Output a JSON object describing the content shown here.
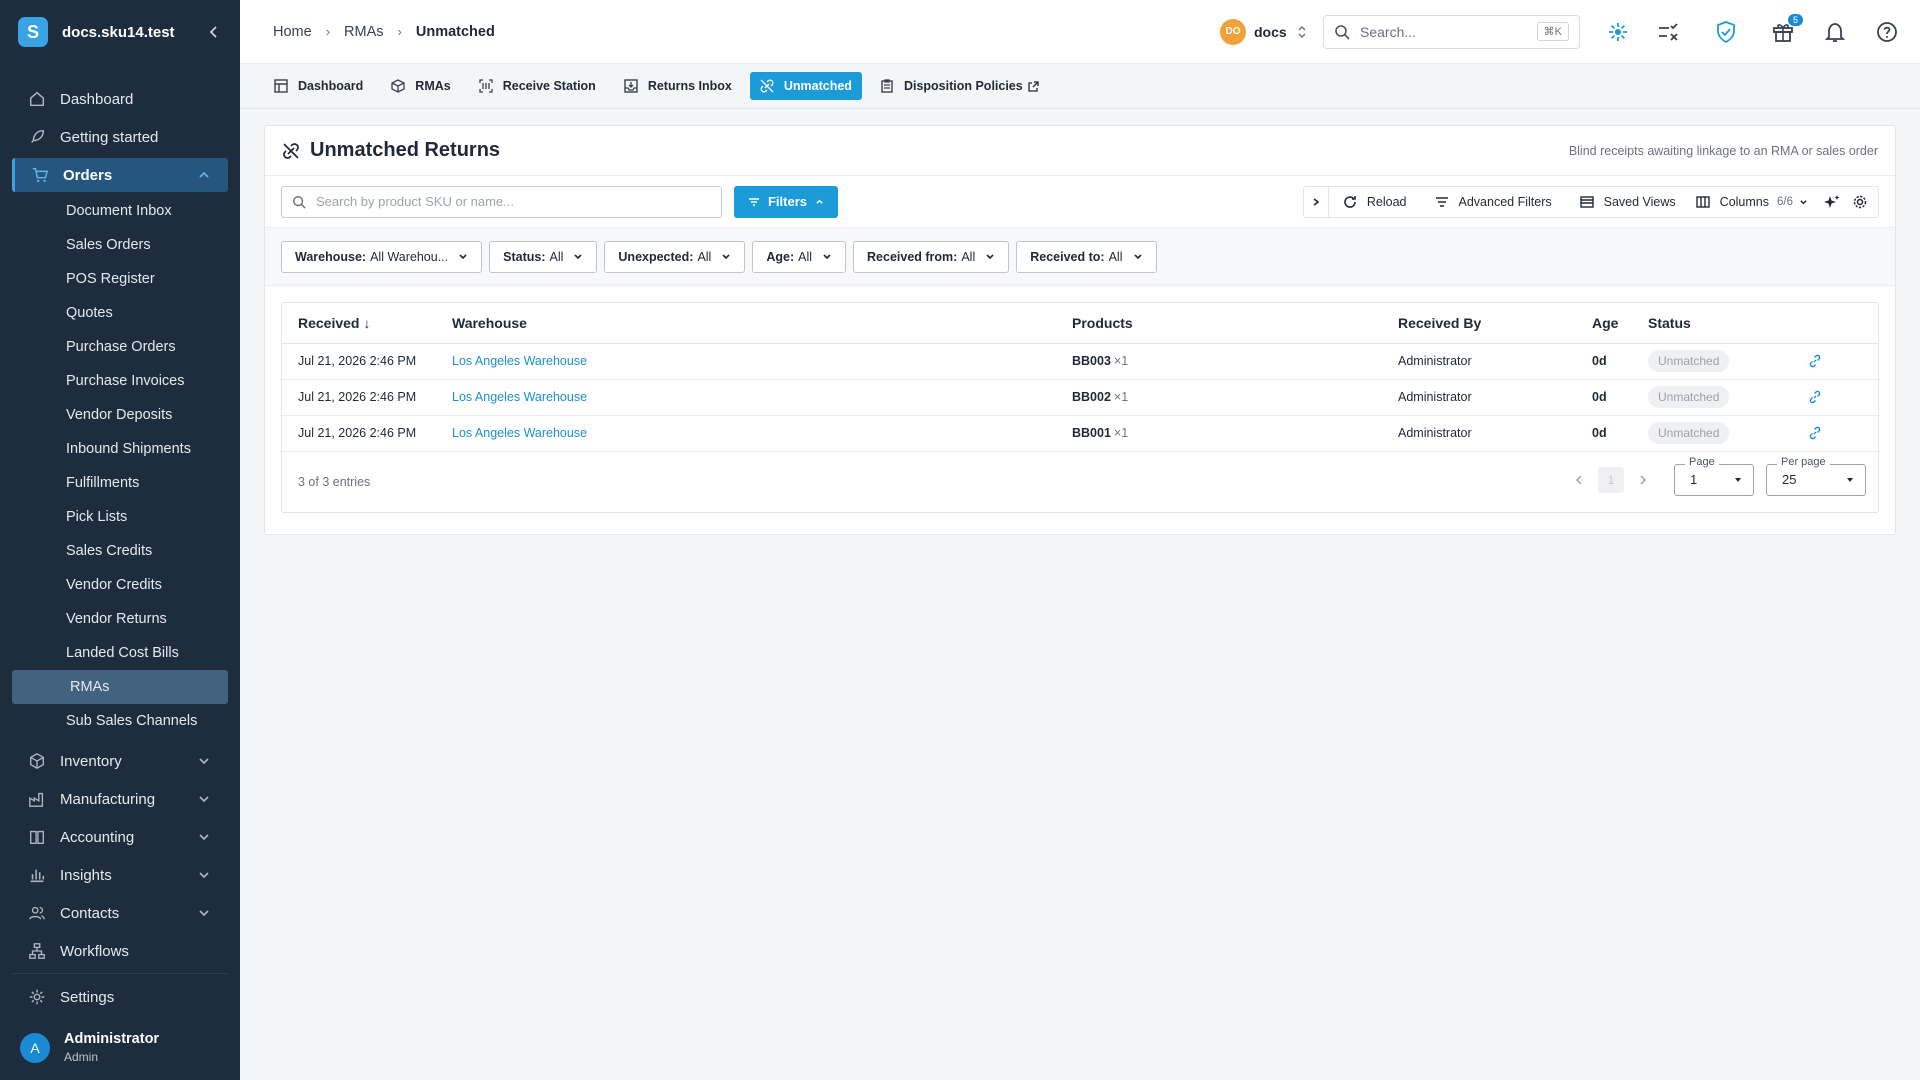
{
  "sidebar": {
    "domain": "docs.sku14.test",
    "top_items": [
      {
        "label": "Dashboard"
      },
      {
        "label": "Getting started"
      },
      {
        "label": "Orders"
      }
    ],
    "orders_sub": [
      "Document Inbox",
      "Sales Orders",
      "POS Register",
      "Quotes",
      "Purchase Orders",
      "Purchase Invoices",
      "Vendor Deposits",
      "Inbound Shipments",
      "Fulfillments",
      "Pick Lists",
      "Sales Credits",
      "Vendor Credits",
      "Vendor Returns",
      "Landed Cost Bills",
      "RMAs",
      "Sub Sales Channels"
    ],
    "bottom_items": [
      {
        "label": "Inventory"
      },
      {
        "label": "Manufacturing"
      },
      {
        "label": "Accounting"
      },
      {
        "label": "Insights"
      },
      {
        "label": "Contacts"
      },
      {
        "label": "Workflows"
      },
      {
        "label": "Settings"
      }
    ],
    "user": {
      "initial": "A",
      "name": "Administrator",
      "role": "Admin"
    }
  },
  "topbar": {
    "breadcrumbs": [
      "Home",
      "RMAs",
      "Unmatched"
    ],
    "workspace": {
      "badge": "DO",
      "name": "docs"
    },
    "search_placeholder": "Search...",
    "search_shortcut": "⌘K",
    "gift_count": "5"
  },
  "tabs": [
    "Dashboard",
    "RMAs",
    "Receive Station",
    "Returns Inbox",
    "Unmatched",
    "Disposition Policies"
  ],
  "page": {
    "title": "Unmatched Returns",
    "subtitle": "Blind receipts awaiting linkage to an RMA or sales order",
    "search_placeholder": "Search by product SKU or name...",
    "filters_label": "Filters",
    "tools": {
      "reload": "Reload",
      "advanced_filters": "Advanced Filters",
      "saved_views": "Saved Views",
      "columns": "Columns",
      "columns_count": "6/6"
    },
    "chips": [
      {
        "key": "Warehouse:",
        "value": "All Warehou..."
      },
      {
        "key": "Status:",
        "value": "All"
      },
      {
        "key": "Unexpected:",
        "value": "All"
      },
      {
        "key": "Age:",
        "value": "All"
      },
      {
        "key": "Received from:",
        "value": "All"
      },
      {
        "key": "Received to:",
        "value": "All"
      }
    ],
    "columns": [
      "Received",
      "Warehouse",
      "Products",
      "Received By",
      "Age",
      "Status"
    ],
    "rows": [
      {
        "received": "Jul 21, 2026 2:46 PM",
        "warehouse": "Los Angeles Warehouse",
        "sku": "BB003",
        "qty": "×1",
        "by": "Administrator",
        "age": "0d",
        "status": "Unmatched"
      },
      {
        "received": "Jul 21, 2026 2:46 PM",
        "warehouse": "Los Angeles Warehouse",
        "sku": "BB002",
        "qty": "×1",
        "by": "Administrator",
        "age": "0d",
        "status": "Unmatched"
      },
      {
        "received": "Jul 21, 2026 2:46 PM",
        "warehouse": "Los Angeles Warehouse",
        "sku": "BB001",
        "qty": "×1",
        "by": "Administrator",
        "age": "0d",
        "status": "Unmatched"
      }
    ],
    "entries_text": "3 of 3 entries",
    "pagination": {
      "current": "1",
      "page_label": "Page",
      "page_value": "1",
      "per_page_label": "Per page",
      "per_page_value": "25"
    }
  }
}
